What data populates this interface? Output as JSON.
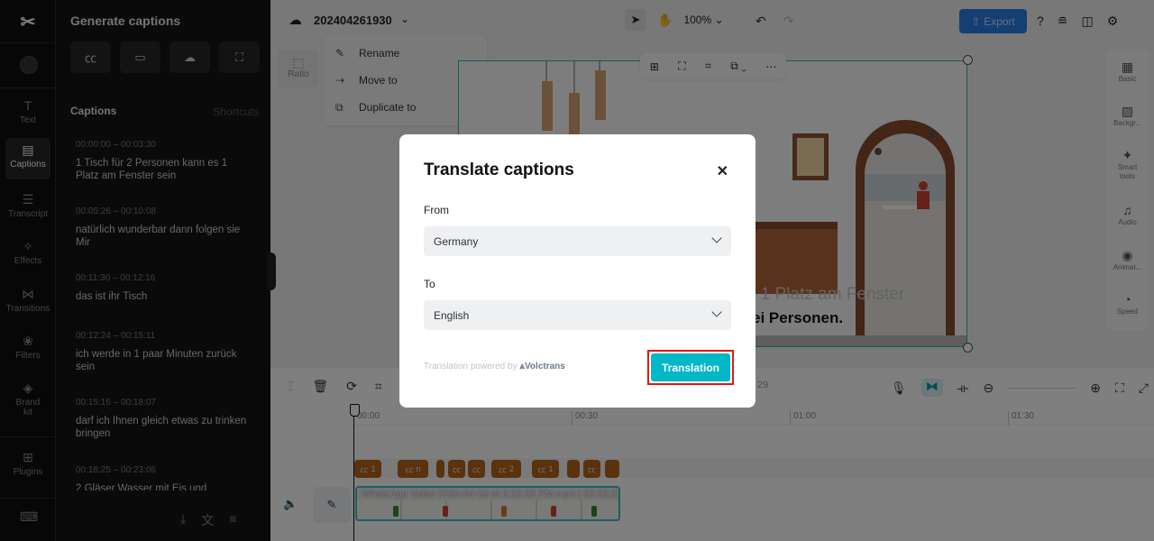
{
  "nav": {
    "logo_icon": "capcut-logo-icon",
    "items": [
      {
        "label": "Text",
        "icon": "T"
      },
      {
        "label": "Captions",
        "icon": "▤"
      },
      {
        "label": "Transcript",
        "icon": "☰"
      },
      {
        "label": "Effects",
        "icon": "✧"
      },
      {
        "label": "Transitions",
        "icon": "⋈"
      },
      {
        "label": "Filters",
        "icon": "❀"
      },
      {
        "label": "Brand kit",
        "icon": "◈"
      },
      {
        "label": "Plugins",
        "icon": "⊞"
      }
    ]
  },
  "captions_panel": {
    "title": "Generate captions",
    "header": "Captions",
    "shortcuts": "Shortcuts",
    "items": [
      {
        "time": "00:00:00 – 00:03:30",
        "text": "1 Tisch für 2 Personen kann es 1 Platz am Fenster sein"
      },
      {
        "time": "00:05:26 – 00:10:08",
        "text": "natürlich wunderbar dann folgen sie Mir"
      },
      {
        "time": "00:11:30 – 00:12:16",
        "text": "das ist ihr Tisch"
      },
      {
        "time": "00:12:24 – 00:15:11",
        "text": "ich werde in 1 paar Minuten zurück sein"
      },
      {
        "time": "00:15:16 – 00:18:07",
        "text": "darf ich Ihnen gleich etwas zu trinken bringen"
      },
      {
        "time": "00:18:25 – 00:23:06",
        "text": "2 Gläser Wasser mit Eis und"
      }
    ]
  },
  "toolbar": {
    "project_name": "202404261930",
    "zoom": "100%",
    "export_label": "Export"
  },
  "context_menu": {
    "items": [
      "Rename",
      "Move to",
      "Duplicate to"
    ]
  },
  "ratio_label": "Ratio",
  "video": {
    "subtitle_line1": "s 1 Platz am Fenster",
    "subtitle_line2": "ei Personen."
  },
  "right_panel": {
    "items": [
      "Basic",
      "Backgr...",
      "Smart tools",
      "Audio",
      "Animat...",
      "Speed"
    ]
  },
  "timeline": {
    "time_partial": "29",
    "ruler": [
      "00:00",
      "00:30",
      "01:00",
      "01:30"
    ],
    "video_clip_label": "WhatsApp Video 2024-04-26 at 8.02.06 PM.mp4 | 00:36:29",
    "caption_chips": [
      "1",
      "n",
      "",
      "",
      "",
      "2",
      "1",
      "",
      "",
      ""
    ]
  },
  "modal": {
    "title": "Translate captions",
    "from_label": "From",
    "from_value": "Germany",
    "to_label": "To",
    "to_value": "English",
    "powered_text": "Translation powered by",
    "powered_brand": "Volctrans",
    "button_label": "Translation",
    "accent": "#00b8c6",
    "highlight": "#e01818"
  }
}
